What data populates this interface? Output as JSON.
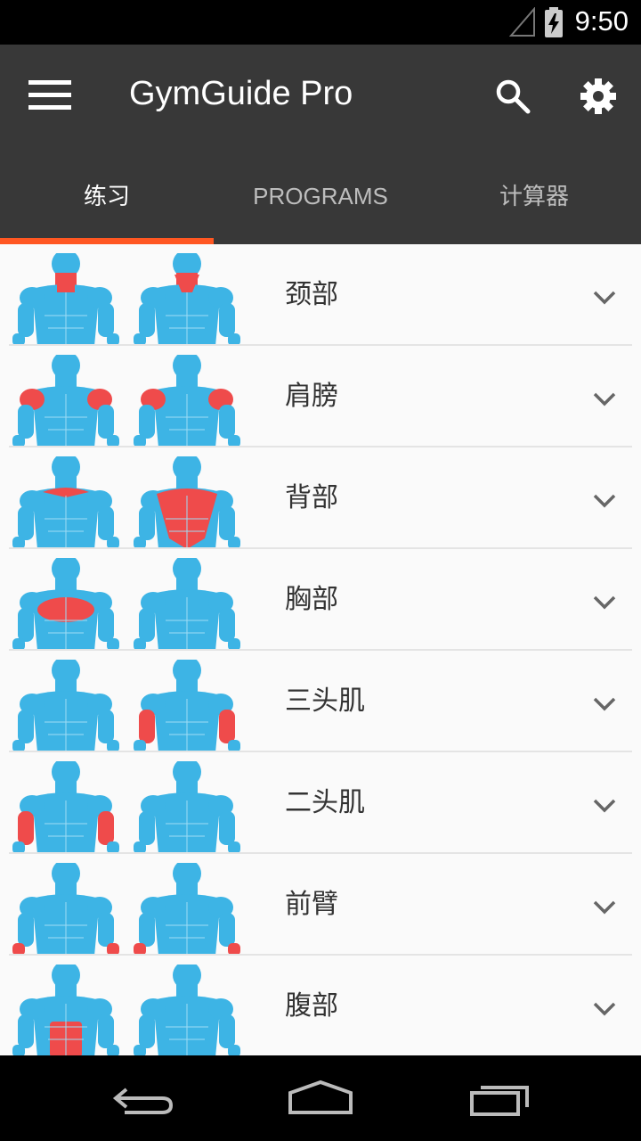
{
  "status_bar": {
    "time": "9:50"
  },
  "app_bar": {
    "title": "GymGuide Pro"
  },
  "tabs": [
    {
      "label": "练习",
      "active": true
    },
    {
      "label": "PROGRAMS",
      "active": false
    },
    {
      "label": "计算器",
      "active": false
    }
  ],
  "colors": {
    "accent": "#ff5722",
    "muscle_base": "#3db4e5",
    "muscle_highlight": "#ef4b4b",
    "app_bar": "#383838"
  },
  "muscle_groups": [
    {
      "label": "颈部"
    },
    {
      "label": "肩膀"
    },
    {
      "label": "背部"
    },
    {
      "label": "胸部"
    },
    {
      "label": "三头肌"
    },
    {
      "label": "二头肌"
    },
    {
      "label": "前臂"
    },
    {
      "label": "腹部"
    }
  ]
}
